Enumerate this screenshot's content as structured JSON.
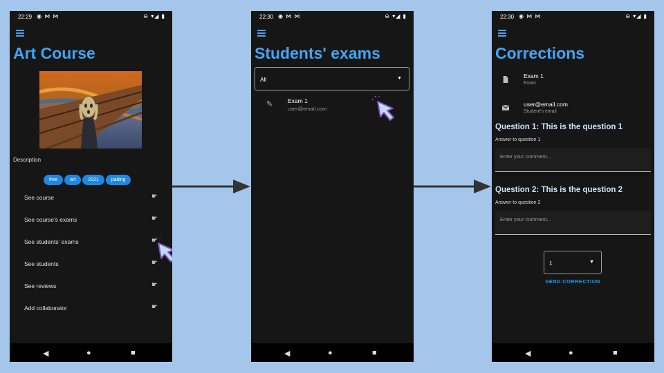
{
  "screen1": {
    "status": {
      "time": "22:29",
      "left_icons": "◉ ⋈ ⋈",
      "right_icons": "⊖ ▾◢ ▮"
    },
    "title": "Art Course",
    "description_label": "Description",
    "tags": [
      "free",
      "art",
      "2021",
      "paiting"
    ],
    "menu": [
      "See course",
      "See course's exams",
      "See students' exams",
      "See students",
      "See reviews",
      "Add collaborator"
    ]
  },
  "screen2": {
    "status": {
      "time": "22:30",
      "left_icons": "◉ ⋈ ⋈",
      "right_icons": "⊖ ▾◢ ▮"
    },
    "title": "Students' exams",
    "filter_value": "All",
    "exam": {
      "name": "Exam 1",
      "email": "user@email.com"
    }
  },
  "screen3": {
    "status": {
      "time": "22:30",
      "left_icons": "◉ ⋈ ⋈",
      "right_icons": "⊖ ▾◢ ▮"
    },
    "title": "Corrections",
    "exam_name": "Exam 1",
    "exam_caption": "Exam",
    "email": "user@email.com",
    "email_caption": "Student's email",
    "questions": [
      {
        "title": "Question 1: This is the question 1",
        "answer": "Answer to question 1",
        "placeholder": "Enter your comment..."
      },
      {
        "title": "Question 2: This is the question 2",
        "answer": "Answer to question 2",
        "placeholder": "Enter your comment..."
      }
    ],
    "grade_value": "1",
    "send_label": "SEND CORRECTION"
  },
  "colors": {
    "background": "#a3c6ea",
    "phone_bg": "#161616",
    "accent": "#42a5f5",
    "chip": "#1e88e5",
    "cursor_fill": "#c5d9f5",
    "cursor_stroke": "#7e57c2"
  }
}
